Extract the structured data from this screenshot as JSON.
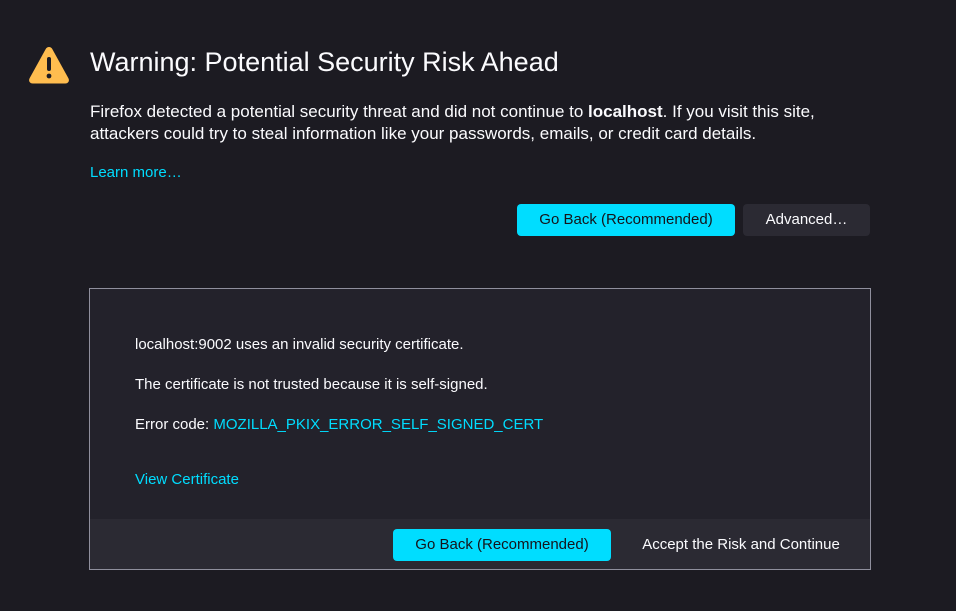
{
  "header": {
    "title": "Warning: Potential Security Risk Ahead"
  },
  "description": {
    "before_host": "Firefox detected a potential security threat and did not continue to ",
    "host": "localhost",
    "after_host": ". If you visit this site, attackers could try to steal information like your passwords, emails, or credit card details."
  },
  "links": {
    "learn_more": "Learn more…"
  },
  "actions": {
    "go_back_label": "Go Back (Recommended)",
    "advanced_label": "Advanced…"
  },
  "advanced_panel": {
    "invalid_cert_text": "localhost:9002 uses an invalid security certificate.",
    "reason_text": "The certificate is not trusted because it is self-signed.",
    "error_code_label": "Error code: ",
    "error_code": "MOZILLA_PKIX_ERROR_SELF_SIGNED_CERT",
    "view_certificate": "View Certificate",
    "go_back_label": "Go Back (Recommended)",
    "accept_label": "Accept the Risk and Continue"
  },
  "icons": {
    "warning": "warning-triangle-icon"
  },
  "colors": {
    "background": "#1c1b22",
    "accent": "#00ddff",
    "warning": "#ffbd4f",
    "panel": "#23222b",
    "panel_footer": "#2b2a33"
  }
}
